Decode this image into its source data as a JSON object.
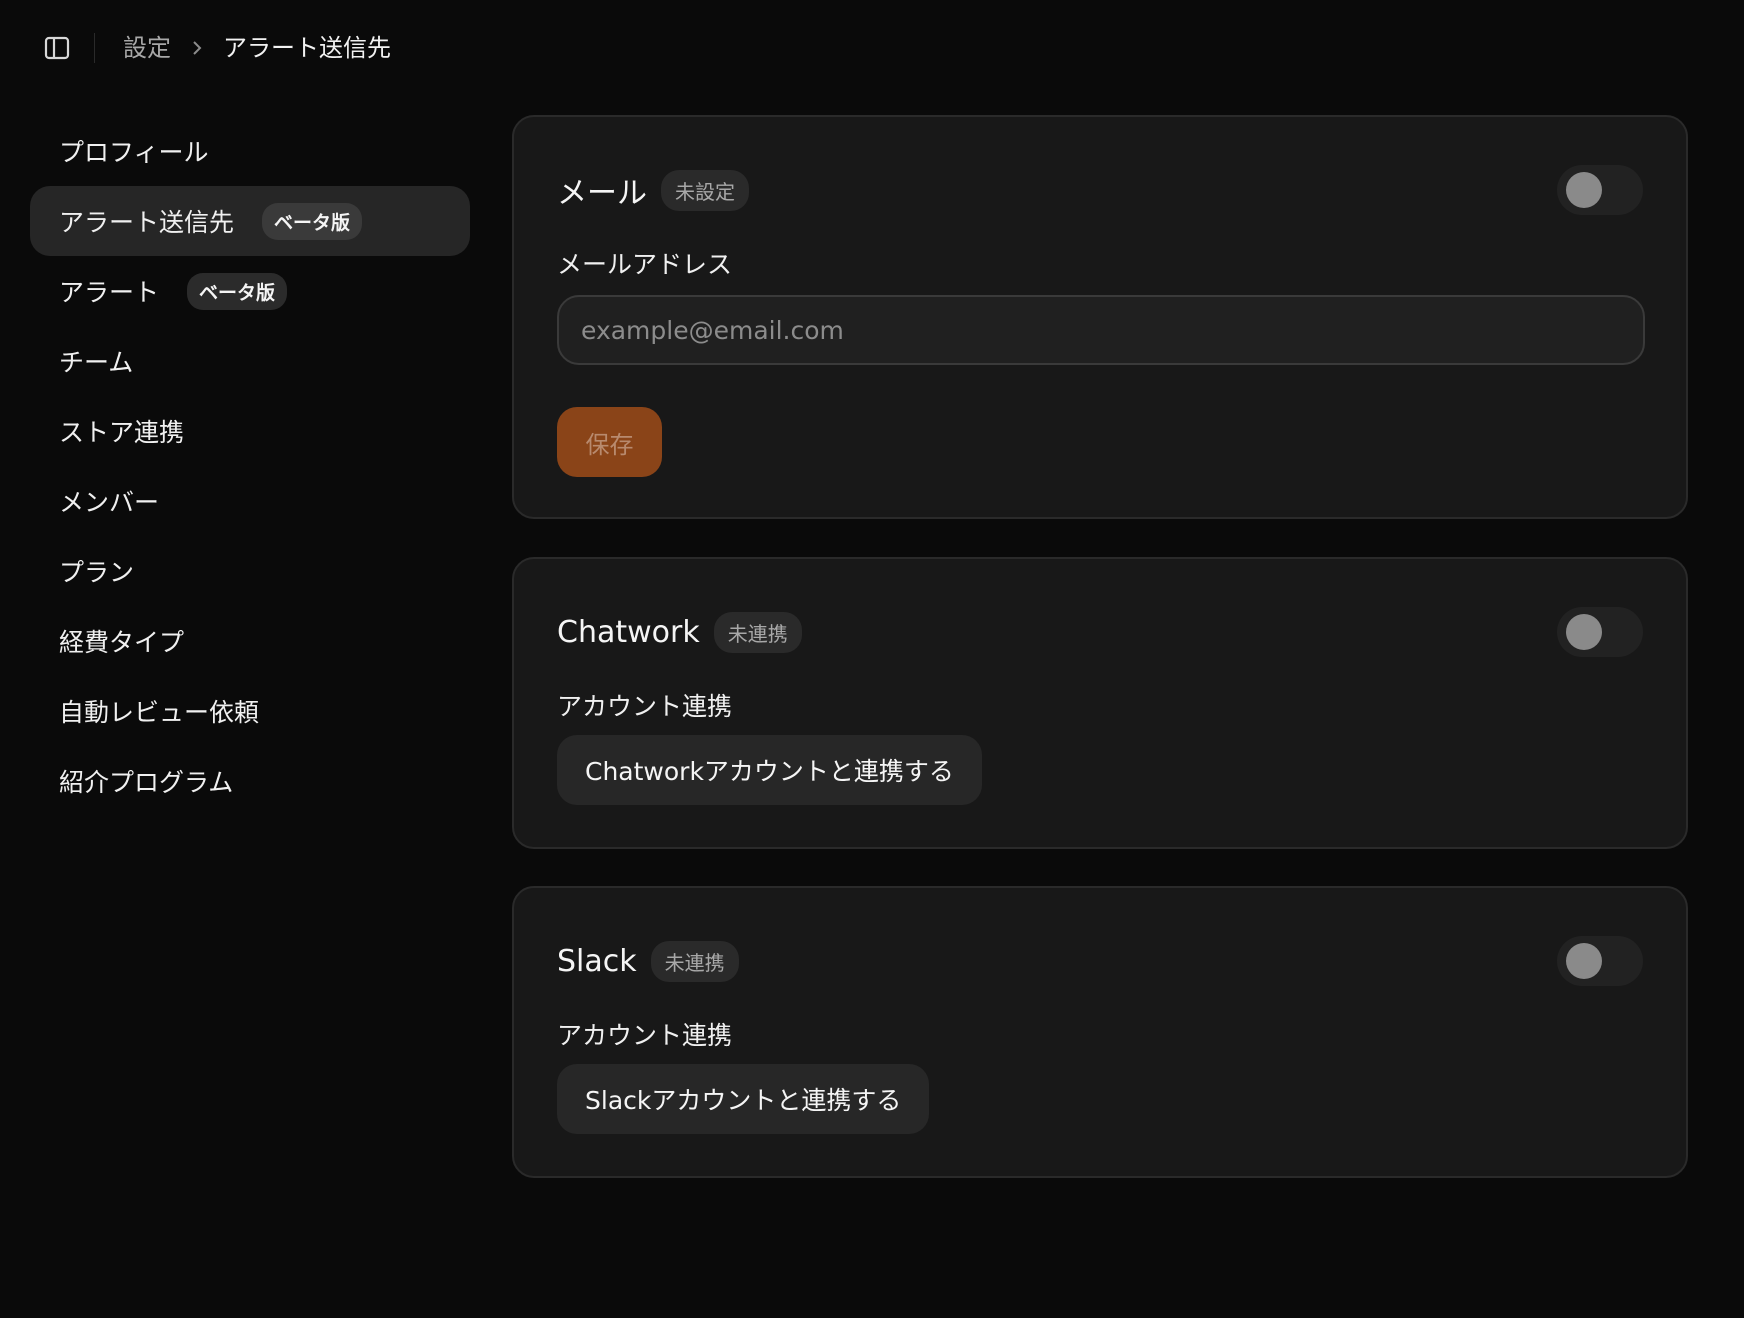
{
  "breadcrumb": {
    "root": "設定",
    "current": "アラート送信先"
  },
  "sidebar": {
    "items": [
      {
        "label": "プロフィール"
      },
      {
        "label": "アラート送信先",
        "badge": "ベータ版",
        "active": true
      },
      {
        "label": "アラート",
        "badge": "ベータ版"
      },
      {
        "label": "チーム"
      },
      {
        "label": "ストア連携"
      },
      {
        "label": "メンバー"
      },
      {
        "label": "プラン"
      },
      {
        "label": "経費タイプ"
      },
      {
        "label": "自動レビュー依頼"
      },
      {
        "label": "紹介プログラム"
      }
    ]
  },
  "email_card": {
    "title": "メール",
    "status": "未設定",
    "enabled": false,
    "field_label": "メールアドレス",
    "placeholder": "example@email.com",
    "value": "",
    "save_label": "保存"
  },
  "chatwork_card": {
    "title": "Chatwork",
    "status": "未連携",
    "enabled": false,
    "field_label": "アカウント連携",
    "connect_label": "Chatworkアカウントと連携する"
  },
  "slack_card": {
    "title": "Slack",
    "status": "未連携",
    "enabled": false,
    "field_label": "アカウント連携",
    "connect_label": "Slackアカウントと連携する"
  },
  "icons": {
    "sidebar_toggle": "sidebar-panel-icon",
    "breadcrumb_separator": "chevron-right-icon"
  },
  "colors": {
    "background": "#0a0a0a",
    "card": "#181818",
    "accent": "#8a4418"
  }
}
